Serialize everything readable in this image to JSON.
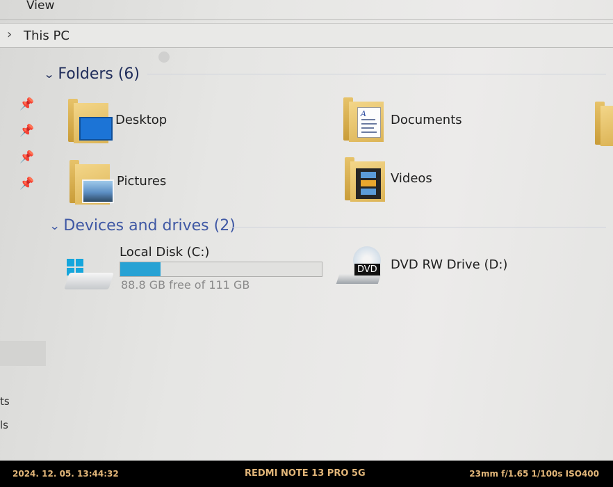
{
  "ribbon": {
    "view_tab": "View"
  },
  "address_bar": {
    "separator": "›",
    "crumb": "This PC"
  },
  "nav_pane": {
    "pins": [
      "📌",
      "📌",
      "📌",
      "📌"
    ],
    "fragments": [
      "ts",
      "ls"
    ]
  },
  "folders_group": {
    "title": "Folders (6)",
    "items": [
      {
        "label": "Desktop",
        "icon": "desktop-folder-icon"
      },
      {
        "label": "Documents",
        "icon": "documents-folder-icon"
      },
      {
        "label": "Pictures",
        "icon": "pictures-folder-icon"
      },
      {
        "label": "Videos",
        "icon": "videos-folder-icon"
      }
    ]
  },
  "drives_group": {
    "title": "Devices and drives (2)",
    "local_disk": {
      "label": "Local Disk (C:)",
      "capacity_text": "88.8 GB free of 111 GB",
      "used_fraction": 0.2,
      "bar_color": "#27a2d4"
    },
    "dvd_drive": {
      "label": "DVD RW Drive (D:)",
      "badge": "DVD"
    }
  },
  "photo_overlay": {
    "datetime": "2024. 12. 05.  13:44:32",
    "device": "REDMI NOTE 13 PRO 5G",
    "settings": "23mm  f/1.65  1/100s  ISO400"
  },
  "colors": {
    "accent": "#3f58a4",
    "folder": "#e7c36a",
    "exif_text": "#e2b679"
  }
}
